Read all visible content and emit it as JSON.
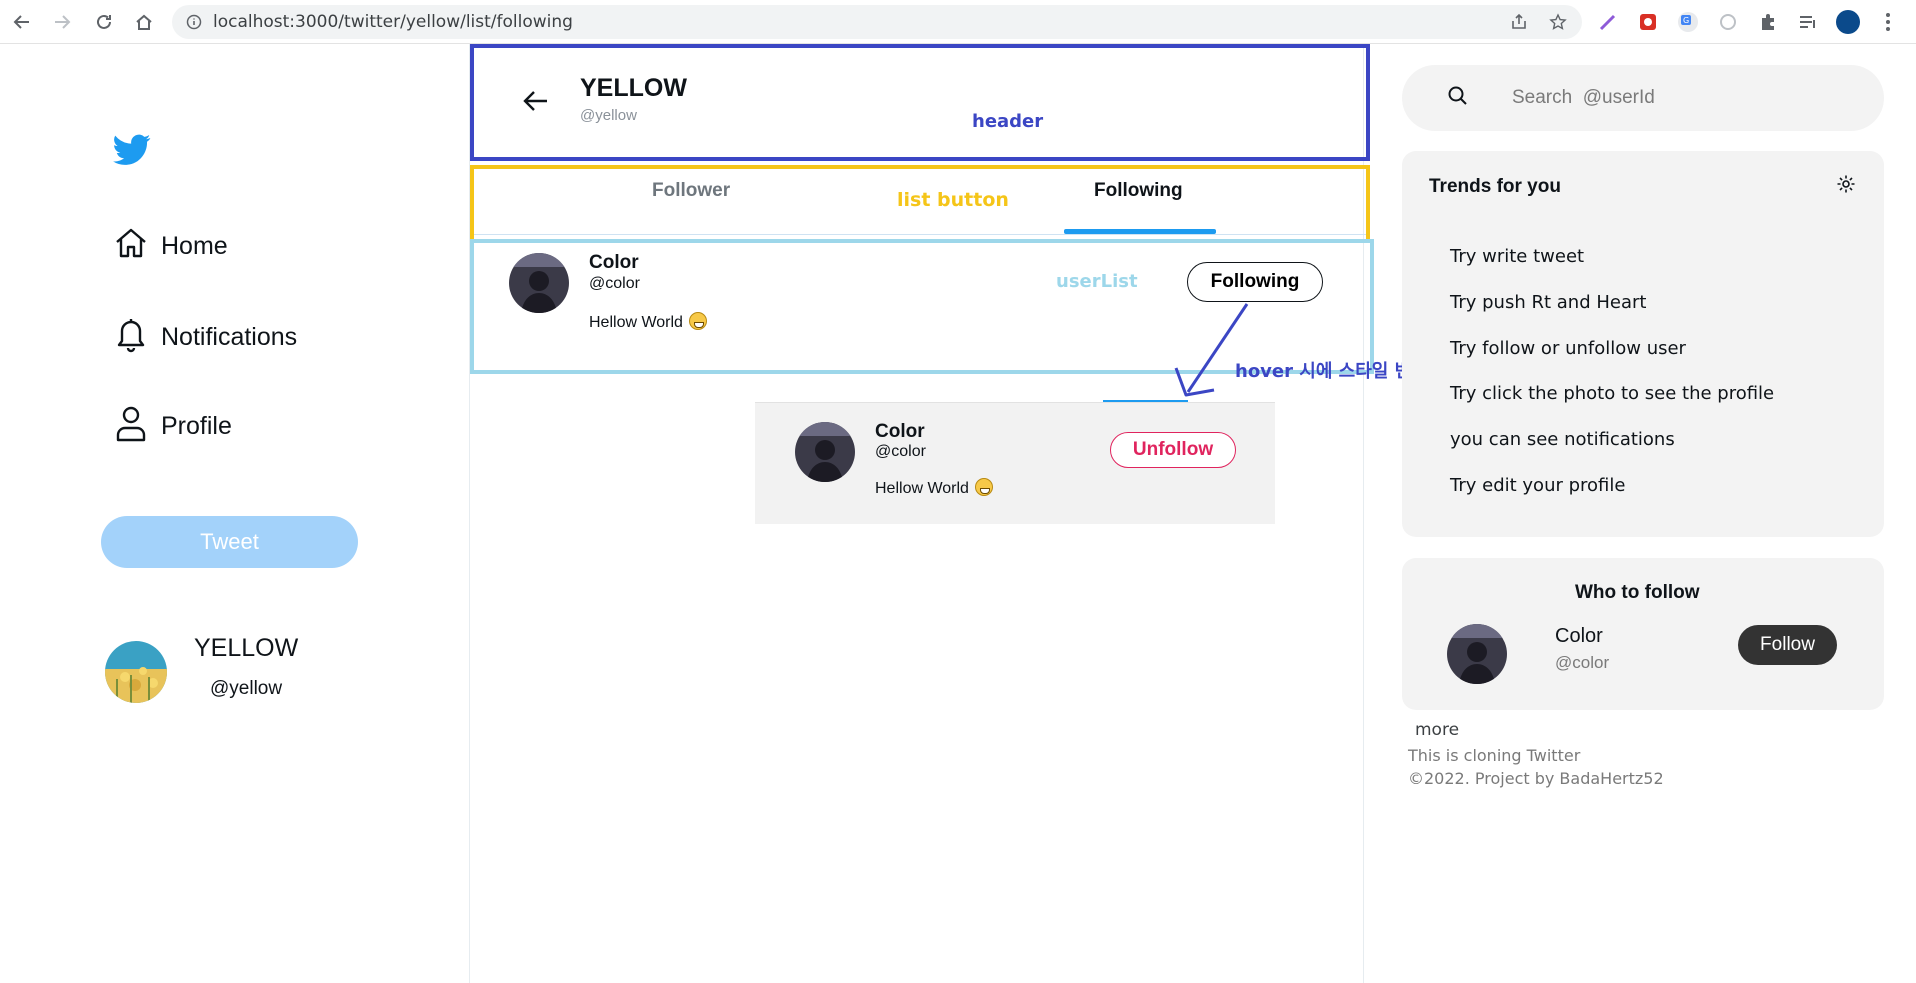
{
  "browser": {
    "url": "localhost:3000/twitter/yellow/list/following"
  },
  "sidebar": {
    "items": [
      {
        "label": "Home",
        "icon": "home-icon"
      },
      {
        "label": "Notifications",
        "icon": "bell-icon"
      },
      {
        "label": "Profile",
        "icon": "person-icon"
      }
    ],
    "tweet_label": "Tweet",
    "me": {
      "name": "YELLOW",
      "handle": "@yellow"
    }
  },
  "header": {
    "name": "YELLOW",
    "handle": "@yellow",
    "annotation": "header"
  },
  "tabs": {
    "follower": "Follower",
    "following": "Following",
    "active": "Following",
    "annotation": "list  button"
  },
  "userlist": {
    "annotation": "userList",
    "users": [
      {
        "name": "Color",
        "handle": "@color",
        "text": "Hellow World",
        "button": "Following"
      }
    ]
  },
  "hover_example": {
    "annotation": "hover 시에 스타일 변경",
    "name": "Color",
    "handle": "@color",
    "text": "Hellow World",
    "button": "Unfollow"
  },
  "search": {
    "placeholder": "Search  @userId"
  },
  "trends": {
    "title": "Trends for you",
    "items": [
      "Try write tweet",
      "Try push Rt and Heart",
      "Try follow or unfollow user",
      "Try click the photo to see the profile",
      "you can see notifications",
      "Try edit your profile"
    ]
  },
  "who_to_follow": {
    "title": "Who to follow",
    "name": "Color",
    "handle": "@color",
    "button": "Follow"
  },
  "footer": {
    "more": "more",
    "line1": "This is cloning Twitter",
    "line2": "©2022.  Project   by   BadaHertz52"
  },
  "colors": {
    "twitter_blue": "#1d9bf0",
    "tweet_button": "#a3d2fa",
    "header_annotation": "#3b46c4",
    "list_annotation": "#f5c518",
    "userlist_annotation": "#9dd7ea",
    "unfollow": "#e0245e"
  }
}
